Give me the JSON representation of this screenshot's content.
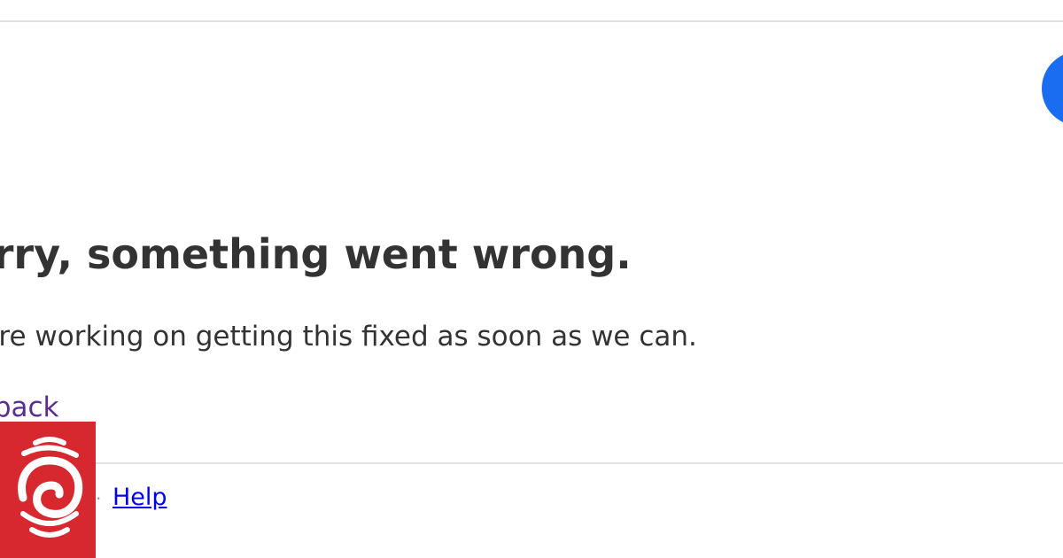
{
  "error": {
    "headline": "Sorry, something went wrong.",
    "message": "We're working on getting this fixed as soon as we can.",
    "back_link": "Go back"
  },
  "footer": {
    "separator": "·",
    "help_link": "Help"
  },
  "logo": {
    "icon": "rnz-spiral-logo",
    "background_color": "#d7282f"
  },
  "colors": {
    "accent_blue": "#1a6df0",
    "text": "#333333",
    "link_visited": "#5c2d91",
    "link": "#0000ee"
  }
}
